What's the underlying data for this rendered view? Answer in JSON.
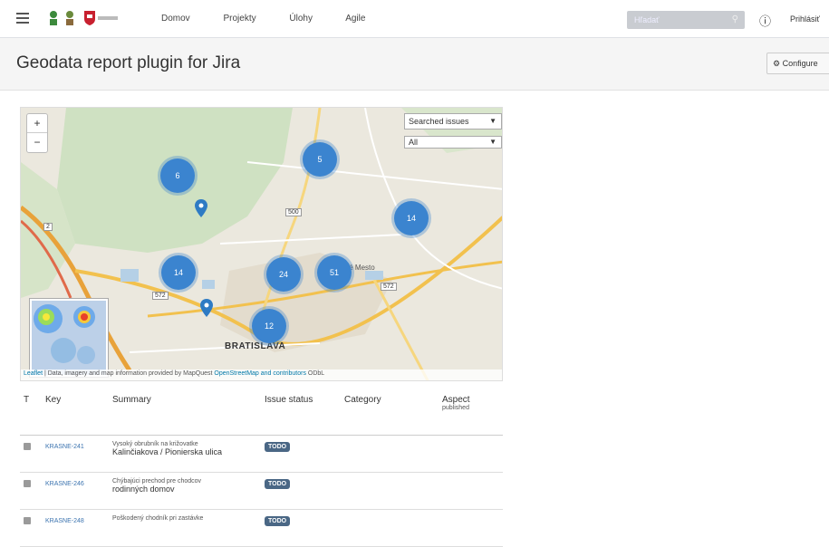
{
  "topbar": {
    "nav_items": [
      "Domov",
      "Projekty",
      "Úlohy",
      "Agile"
    ],
    "search_placeholder": "Hľadať",
    "user_label": "Prihlásiť"
  },
  "page": {
    "title": "Geodata report plugin for Jira",
    "configure_label": "Configure"
  },
  "map": {
    "zoom_in": "+",
    "zoom_out": "−",
    "layer_select": "Searched issues",
    "filter_select": "All",
    "clusters": [
      "6",
      "5",
      "14",
      "14",
      "24",
      "51",
      "12"
    ],
    "city_label": "BRATISLAVA",
    "district_label": "Nové Mesto",
    "road_labels": [
      "2",
      "500",
      "572",
      "572"
    ],
    "attribution": {
      "leaflet": "Leaflet",
      "text": " | Data, imagery and map information provided by MapQuest ",
      "osm": "OpenStreetMap and contributors",
      "license": " ODbL"
    }
  },
  "table": {
    "headers": {
      "type": "T",
      "key": "Key",
      "summary": "Summary",
      "status": "Issue status",
      "category": "Category",
      "aspect": "Aspect",
      "aspect_sub": "published"
    },
    "rows": [
      {
        "key": "KRASNE-241",
        "summary_line1": "Vysoký obrubník na križovatke",
        "summary_line2": "Kalinčiakova / Pionierska ulica",
        "status": "TODO"
      },
      {
        "key": "KRASNE-246",
        "summary_line1": "Chýbajúci prechod pre chodcov",
        "summary_line2": "rodinných domov",
        "status": "TODO"
      },
      {
        "key": "KRASNE-248",
        "summary_line1": "Poškodený chodník pri zastávke",
        "summary_line2": "",
        "status": "TODO"
      }
    ]
  }
}
